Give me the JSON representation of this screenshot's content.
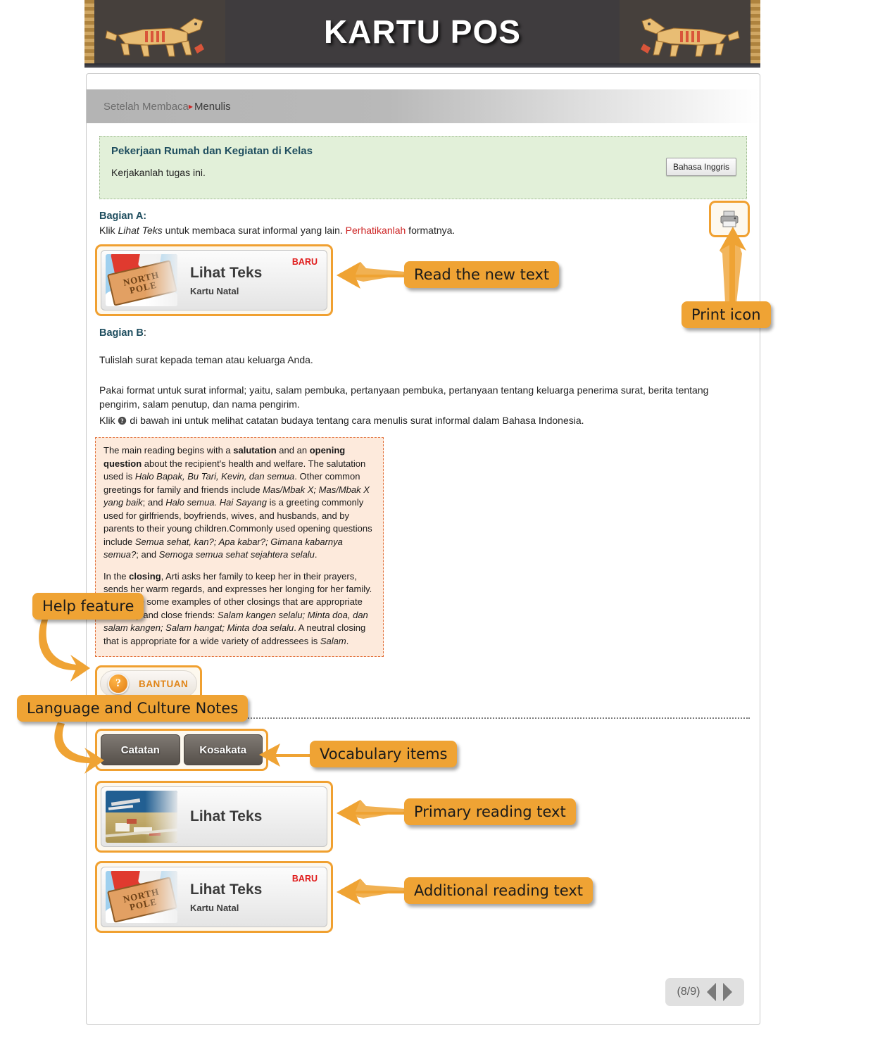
{
  "banner": {
    "title": "KARTU POS"
  },
  "breadcrumb": {
    "parent": "Setelah Membaca",
    "separator": "▸",
    "current": "Menulis"
  },
  "task_box": {
    "title": "Pekerjaan Rumah dan Kegiatan di Kelas",
    "subtitle": "Kerjakanlah tugas ini.",
    "language_button": "Bahasa Inggris"
  },
  "print": {
    "icon": "printer-icon"
  },
  "section_a": {
    "heading": "Bagian A:",
    "instruction_1": "Klik ",
    "instruction_link": "Lihat Teks",
    "instruction_2": " untuk membaca surat informal yang lain. ",
    "instruction_em": "Perhatikanlah",
    "instruction_3": " formatnya."
  },
  "card_a": {
    "title": "Lihat Teks",
    "subtitle": "Kartu Natal",
    "badge": "BARU",
    "thumb": "north-pole-image"
  },
  "section_b": {
    "heading": "Bagian B",
    "heading_colon": ":",
    "line1": "Tulislah surat kepada teman atau keluarga Anda.",
    "line2": "Pakai format untuk surat informal; yaitu, salam pembuka, pertanyaan pembuka, pertanyaan tentang keluarga penerima surat, berita tentang pengirim, salam penutup, dan nama pengirim.",
    "line3_pre": "Klik ",
    "line3_icon": "help-circle-icon",
    "line3_post": " di bawah ini untuk melihat catatan budaya tentang cara menulis surat informal dalam Bahasa Indonesia."
  },
  "notes_box": {
    "paragraph_1": {
      "t1": "The main reading begins with a ",
      "b1": "salutation",
      "t2": " and an ",
      "b2": "opening question",
      "t3": " about the recipient's health and welfare. The salutation used is ",
      "i1": "Halo Bapak, Bu Tari, Kevin, dan semua",
      "t4": ". Other common greetings for family and friends include ",
      "i2": "Mas/Mbak X; Mas/Mbak X yang baik",
      "t5": "; and ",
      "i3": "Halo semua. Hai Sayang",
      "t6": " is a greeting commonly used for girlfriends, boyfriends, wives, and husbands, and by parents to their young children.Commonly used opening questions include ",
      "i4": "Semua sehat, kan?; Apa kabar?; Gimana kabarnya semua?",
      "t7": "; and ",
      "i5": "Semoga semua sehat sejahtera selalu",
      "t8": "."
    },
    "paragraph_2": {
      "t1": "In the ",
      "b1": "closing",
      "t2": ", Arti asks her family to keep her in their prayers, sends her warm regards, and expresses her longing for her family. Below are some examples of other closings that are appropriate for family and close friends: ",
      "i1": "Salam kangen selalu; Minta doa, dan salam kangen; Salam hangat; Minta doa selalu",
      "t3": ". A neutral closing that is appropriate for a wide variety of addressees is ",
      "i2": "Salam",
      "t4": "."
    }
  },
  "bantuan": {
    "label": "BANTUAN",
    "icon": "question-mark-icon"
  },
  "tabs": [
    {
      "label": "Catatan",
      "name": "tab-catatan"
    },
    {
      "label": "Kosakata",
      "name": "tab-kosakata"
    }
  ],
  "card_b": {
    "title": "Lihat Teks",
    "subtitle": "",
    "badge": "",
    "thumb": "harbour-aerial-image"
  },
  "card_c": {
    "title": "Lihat Teks",
    "subtitle": "Kartu Natal",
    "badge": "BARU",
    "thumb": "north-pole-image"
  },
  "pager": {
    "page_label": "(8/9)",
    "prev": "prev-arrow",
    "next": "next-arrow"
  },
  "annotations": [
    {
      "id": "read-new-text",
      "text": "Read the new text"
    },
    {
      "id": "print-icon",
      "text": "Print icon"
    },
    {
      "id": "help-feature",
      "text": "Help feature"
    },
    {
      "id": "language-culture",
      "text": "Language and Culture Notes"
    },
    {
      "id": "vocabulary-items",
      "text": "Vocabulary items"
    },
    {
      "id": "primary-reading",
      "text": "Primary reading text"
    },
    {
      "id": "additional-reading",
      "text": "Additional reading text"
    }
  ],
  "colors": {
    "accent_orange": "#efa334",
    "banner_bg": "#3f3c3e",
    "green_box": "#e2f0d9",
    "notes_box": "#fdeadc",
    "badge_red": "#e01b1b"
  }
}
